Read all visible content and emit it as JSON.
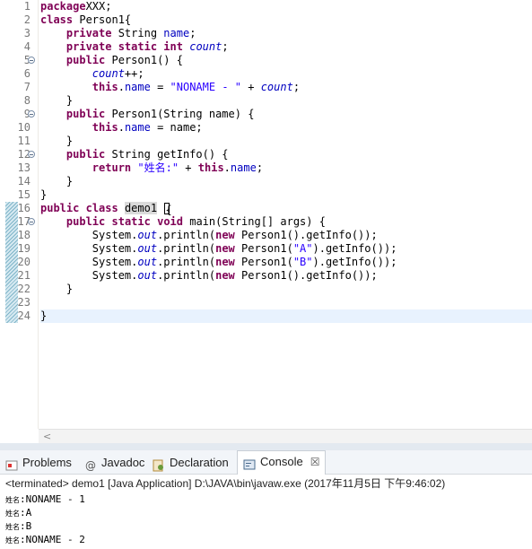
{
  "editor": {
    "lines": [
      {
        "n": "1",
        "fold": false,
        "parts": [
          [
            "kw",
            "package"
          ],
          [
            "",
            "XXX;"
          ]
        ]
      },
      {
        "n": "2",
        "fold": false,
        "parts": [
          [
            "kw",
            "class"
          ],
          [
            "",
            " Person1{"
          ]
        ]
      },
      {
        "n": "3",
        "fold": false,
        "parts": [
          [
            "",
            "    "
          ],
          [
            "kw",
            "private"
          ],
          [
            "",
            " String "
          ],
          [
            "fld",
            "name"
          ],
          [
            "",
            ";"
          ]
        ]
      },
      {
        "n": "4",
        "fold": false,
        "parts": [
          [
            "",
            "    "
          ],
          [
            "kw",
            "private"
          ],
          [
            "",
            ""
          ],
          [
            "kw",
            " static"
          ],
          [
            "",
            " "
          ],
          [
            "kw",
            "int"
          ],
          [
            "",
            " "
          ],
          [
            "sfld",
            "count"
          ],
          [
            "",
            ";"
          ]
        ]
      },
      {
        "n": "5",
        "fold": true,
        "parts": [
          [
            "",
            "    "
          ],
          [
            "kw",
            "public"
          ],
          [
            "",
            " Person1() {"
          ]
        ]
      },
      {
        "n": "6",
        "fold": false,
        "parts": [
          [
            "",
            "        "
          ],
          [
            "sfld",
            "count"
          ],
          [
            "",
            "++;"
          ]
        ]
      },
      {
        "n": "7",
        "fold": false,
        "parts": [
          [
            "",
            "        "
          ],
          [
            "kw",
            "this"
          ],
          [
            "",
            "."
          ],
          [
            "fld",
            "name"
          ],
          [
            "",
            " = "
          ],
          [
            "str",
            "\"NONAME - \""
          ],
          [
            "",
            " + "
          ],
          [
            "sfld",
            "count"
          ],
          [
            "",
            ";"
          ]
        ]
      },
      {
        "n": "8",
        "fold": false,
        "parts": [
          [
            "",
            "    }"
          ]
        ]
      },
      {
        "n": "9",
        "fold": true,
        "parts": [
          [
            "",
            "    "
          ],
          [
            "kw",
            "public"
          ],
          [
            "",
            " Person1(String name) {"
          ]
        ]
      },
      {
        "n": "10",
        "fold": false,
        "parts": [
          [
            "",
            "        "
          ],
          [
            "kw",
            "this"
          ],
          [
            "",
            "."
          ],
          [
            "fld",
            "name"
          ],
          [
            "",
            " = name;"
          ]
        ]
      },
      {
        "n": "11",
        "fold": false,
        "parts": [
          [
            "",
            "    }"
          ]
        ]
      },
      {
        "n": "12",
        "fold": true,
        "parts": [
          [
            "",
            "    "
          ],
          [
            "kw",
            "public"
          ],
          [
            "",
            " String getInfo() {"
          ]
        ]
      },
      {
        "n": "13",
        "fold": false,
        "parts": [
          [
            "",
            "        "
          ],
          [
            "kw",
            "return"
          ],
          [
            "",
            " "
          ],
          [
            "str",
            "\"姓名:\""
          ],
          [
            "",
            " + "
          ],
          [
            "kw",
            "this"
          ],
          [
            "",
            "."
          ],
          [
            "fld",
            "name"
          ],
          [
            "",
            ";"
          ]
        ]
      },
      {
        "n": "14",
        "fold": false,
        "parts": [
          [
            "",
            "    }"
          ]
        ]
      },
      {
        "n": "15",
        "fold": false,
        "parts": [
          [
            "",
            "}"
          ]
        ]
      },
      {
        "n": "16",
        "fold": false,
        "parts": [
          [
            "kw",
            "public"
          ],
          [
            "",
            " "
          ],
          [
            "kw",
            "class"
          ],
          [
            "",
            " "
          ],
          [
            "sel",
            "demo1"
          ],
          [
            "",
            " "
          ],
          [
            "caret",
            "{"
          ]
        ]
      },
      {
        "n": "17",
        "fold": true,
        "parts": [
          [
            "",
            "    "
          ],
          [
            "kw",
            "public"
          ],
          [
            "",
            " "
          ],
          [
            "kw",
            "static"
          ],
          [
            "",
            " "
          ],
          [
            "kw",
            "void"
          ],
          [
            "",
            " main(String[] args) {"
          ]
        ]
      },
      {
        "n": "18",
        "fold": false,
        "parts": [
          [
            "",
            "        System."
          ],
          [
            "sfld",
            "out"
          ],
          [
            "",
            ".println("
          ],
          [
            "kw",
            "new"
          ],
          [
            "",
            " Person1().getInfo());"
          ]
        ]
      },
      {
        "n": "19",
        "fold": false,
        "parts": [
          [
            "",
            "        System."
          ],
          [
            "sfld",
            "out"
          ],
          [
            "",
            ".println("
          ],
          [
            "kw",
            "new"
          ],
          [
            "",
            " Person1("
          ],
          [
            "str",
            "\"A\""
          ],
          [
            "",
            ").getInfo());"
          ]
        ]
      },
      {
        "n": "20",
        "fold": false,
        "parts": [
          [
            "",
            "        System."
          ],
          [
            "sfld",
            "out"
          ],
          [
            "",
            ".println("
          ],
          [
            "kw",
            "new"
          ],
          [
            "",
            " Person1("
          ],
          [
            "str",
            "\"B\""
          ],
          [
            "",
            ").getInfo());"
          ]
        ]
      },
      {
        "n": "21",
        "fold": false,
        "parts": [
          [
            "",
            "        System."
          ],
          [
            "sfld",
            "out"
          ],
          [
            "",
            ".println("
          ],
          [
            "kw",
            "new"
          ],
          [
            "",
            " Person1().getInfo());"
          ]
        ]
      },
      {
        "n": "22",
        "fold": false,
        "parts": [
          [
            "",
            "    }"
          ]
        ]
      },
      {
        "n": "23",
        "fold": false,
        "parts": [
          [
            "",
            ""
          ]
        ]
      },
      {
        "n": "24",
        "fold": false,
        "parts": [
          [
            "",
            "}"
          ]
        ]
      }
    ],
    "current_line": "24"
  },
  "tabs": [
    {
      "name": "tab-problems",
      "icon": "problems-icon",
      "label": "Problems",
      "active": false
    },
    {
      "name": "tab-javadoc",
      "icon": "javadoc-icon",
      "label": "Javadoc",
      "active": false
    },
    {
      "name": "tab-declaration",
      "icon": "declaration-icon",
      "label": "Declaration",
      "active": false
    },
    {
      "name": "tab-console",
      "icon": "console-icon",
      "label": "Console",
      "active": true
    }
  ],
  "console": {
    "status": "<terminated> demo1 [Java Application] D:\\JAVA\\bin\\javaw.exe (2017年11月5日 下午9:46:02)",
    "output": [
      {
        "prefix": "姓名",
        "text": ":NONAME - 1"
      },
      {
        "prefix": "姓名",
        "text": ":A"
      },
      {
        "prefix": "姓名",
        "text": ":B"
      },
      {
        "prefix": "姓名",
        "text": ":NONAME - 2"
      }
    ]
  },
  "colors": {
    "keyword": "#7f0055",
    "field": "#0000c0",
    "string": "#2a00ff",
    "current_line": "#e8f2fe"
  }
}
